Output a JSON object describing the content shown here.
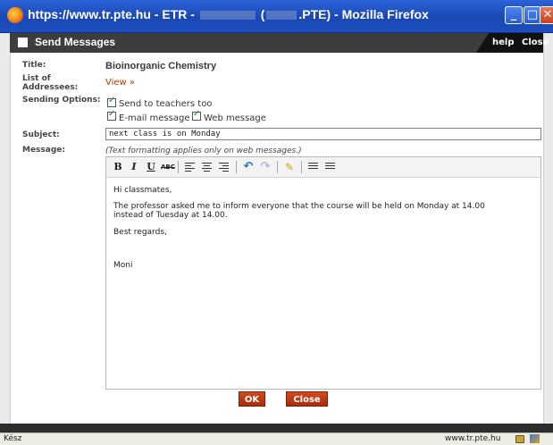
{
  "window": {
    "title_prefix": "https://www.tr.pte.hu - ETR - ",
    "title_mid": " (",
    "title_suffix": ".PTE) - Mozilla Firefox",
    "minimize": "_",
    "maximize": "□",
    "close": "✕"
  },
  "dialog": {
    "title": "Send Messages",
    "help": "help",
    "close": "Close"
  },
  "form": {
    "title_label": "Title:",
    "title_value": "Bioinorganic Chemistry",
    "addressees_label": "List of Addressees:",
    "view_link": "View »",
    "sending_label": "Sending Options:",
    "opt_teachers": "Send to teachers too",
    "opt_email": "E-mail message",
    "opt_web": "Web message",
    "subject_label": "Subject:",
    "subject_value": "next class is on Monday",
    "message_label": "Message:",
    "format_note": "(Text formatting applies only on web messages.)"
  },
  "toolbar": {
    "bold": "B",
    "italic": "I",
    "underline": "U",
    "strike": "ABC"
  },
  "message": {
    "line1": "Hi classmates,",
    "line2": "The professor asked me to inform everyone that the course will be held on Monday at 14.00",
    "line3": "instead of Tuesday at 14.00.",
    "line4": "Best regards,",
    "line5": "Moni"
  },
  "buttons": {
    "ok": "OK",
    "close": "Close"
  },
  "status": {
    "left": "Kész",
    "url": "www.tr.pte.hu"
  }
}
